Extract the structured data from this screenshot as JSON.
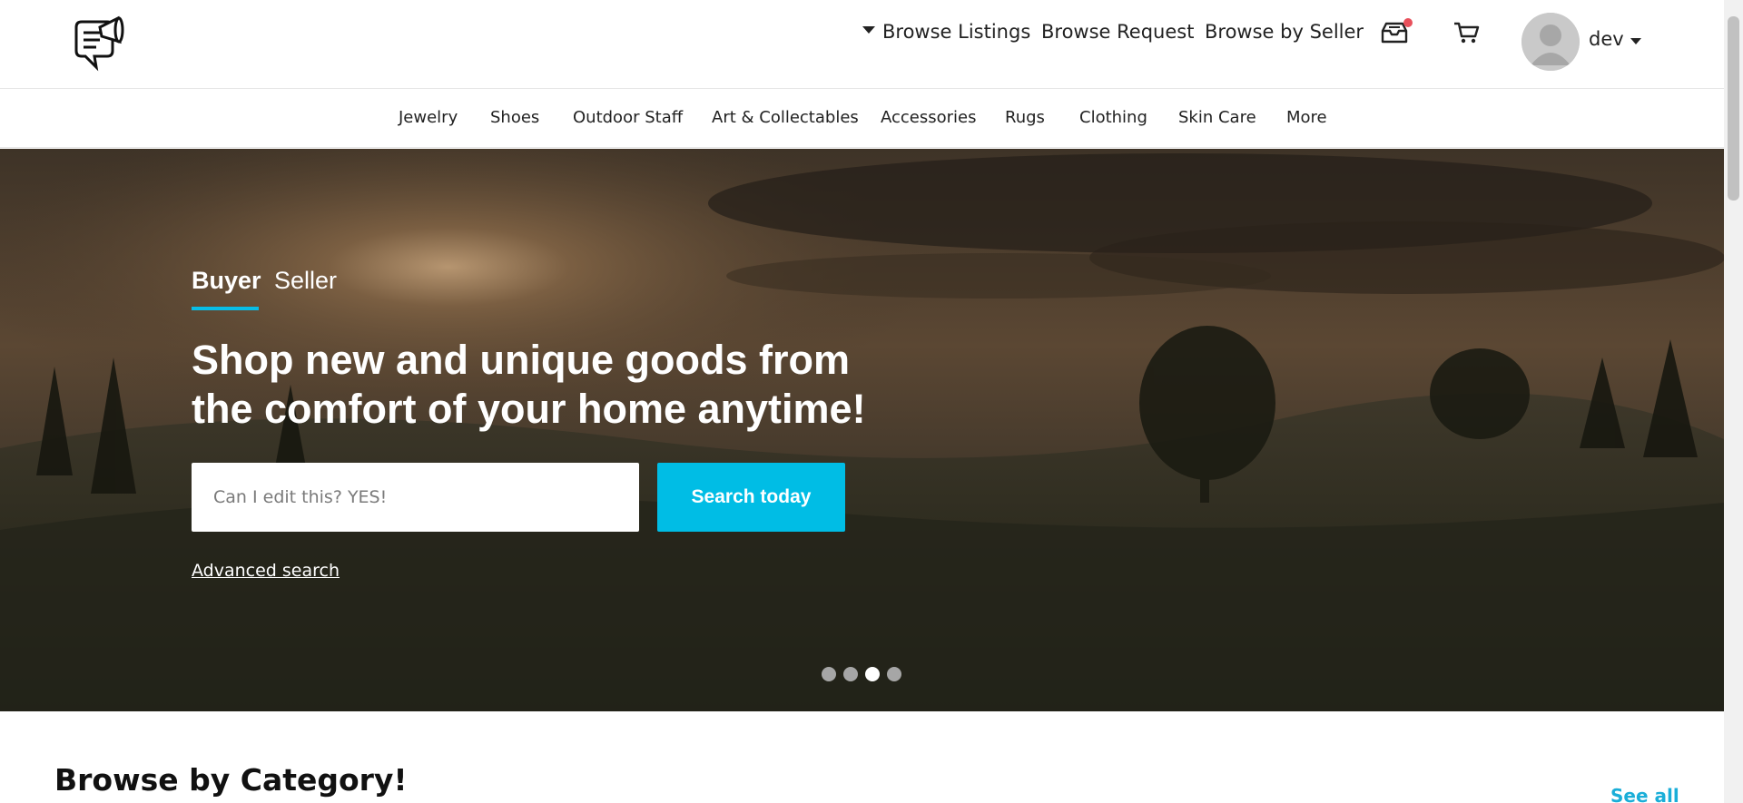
{
  "header": {
    "logo": "chat-megaphone-logo-icon",
    "nav": {
      "browse_listings": "Browse Listings",
      "browse_request": "Browse Request",
      "browse_by_seller": "Browse by Seller"
    },
    "icons": [
      "inbox-icon",
      "cart-icon"
    ],
    "inbox_badge_color": "#e8505b",
    "user": {
      "name": "dev",
      "avatar": "avatar-placeholder-icon"
    }
  },
  "categories": [
    "Jewelry",
    "Shoes",
    "Outdoor Staff",
    "Art & Collectables",
    "Accessories",
    "Rugs",
    "Clothing",
    "Skin Care",
    "More"
  ],
  "hero": {
    "tabs": [
      {
        "label": "Buyer",
        "active": true
      },
      {
        "label": "Seller",
        "active": false
      }
    ],
    "title_line1": "Shop new and unique goods from",
    "title_line2": "the comfort of your home anytime!",
    "search": {
      "value": "",
      "placeholder": "Can I edit this? YES!",
      "button_label": "Search today"
    },
    "advanced_search_label": "Advanced search",
    "carousel": {
      "slides": 4,
      "active_index": 3
    }
  },
  "sections": {
    "browse_by_category": {
      "title": "Browse by Category!",
      "see_all_label": "See all"
    }
  },
  "colors": {
    "accent": "#00bde5",
    "link": "#1aaed8",
    "tab_underline": "#09bde6"
  }
}
